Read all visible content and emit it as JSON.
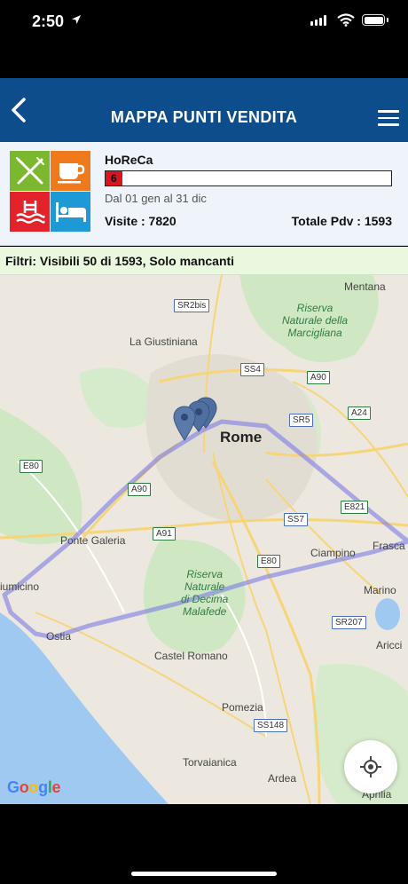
{
  "status_bar": {
    "time": "2:50"
  },
  "navbar": {
    "title": "MAPPA PUNTI VENDITA"
  },
  "summary": {
    "category": "HoReCa",
    "progress_value": "6",
    "progress_fraction": 0.06,
    "period": "Dal 01 gen al 31 dic",
    "visits": "Visite : 7820",
    "totals": "Totale Pdv : 1593"
  },
  "filter": {
    "text": "Filtri:  Visibili 50 di 1593, Solo mancanti"
  },
  "map": {
    "labels": {
      "mentana": "Mentana",
      "la_giustiniana": "La Giustiniana",
      "rome": "Rome",
      "ponte_galeria": "Ponte Galeria",
      "fiumicino": "iumicino",
      "ciampino": "Ciampino",
      "frascati": "Frasca",
      "marino": "Marino",
      "ostia": "Ostia",
      "castel_romano": "Castel Romano",
      "pomezia": "Pomezia",
      "torvaianica": "Torvaianica",
      "ardea": "Ardea",
      "ariccia": "Aricci",
      "aprilia": "Aprilia"
    },
    "parks": {
      "marcigliana_1": "Riserva",
      "marcigliana_2": "Naturale della",
      "marcigliana_3": "Marcigliana",
      "decima_1": "Riserva",
      "decima_2": "Naturale",
      "decima_3": "di Decima",
      "decima_4": "Malafede"
    },
    "roads": {
      "sr2bis": "SR2bis",
      "a90_n": "A90",
      "ss4": "SS4",
      "sr5": "SR5",
      "a24": "A24",
      "e80_w": "E80",
      "a90_w": "A90",
      "a91": "A91",
      "ss7": "SS7",
      "e821": "E821",
      "e80_s": "E80",
      "sr207": "SR207",
      "ss148": "SS148"
    },
    "google": "Google"
  },
  "colors": {
    "navbar": "#0e4d8b",
    "progress_fill": "#d9151f",
    "filter_bg": "#e9f8de",
    "route": "#7b7be8",
    "marker": "#4f6fa1"
  },
  "icons": {
    "back": "chevron-left-icon",
    "menu": "hamburger-menu-icon",
    "restaurant": "fork-knife-icon",
    "cafe": "coffee-cup-icon",
    "pool": "swimming-pool-icon",
    "hotel": "bed-icon",
    "locate": "crosshair-icon"
  }
}
